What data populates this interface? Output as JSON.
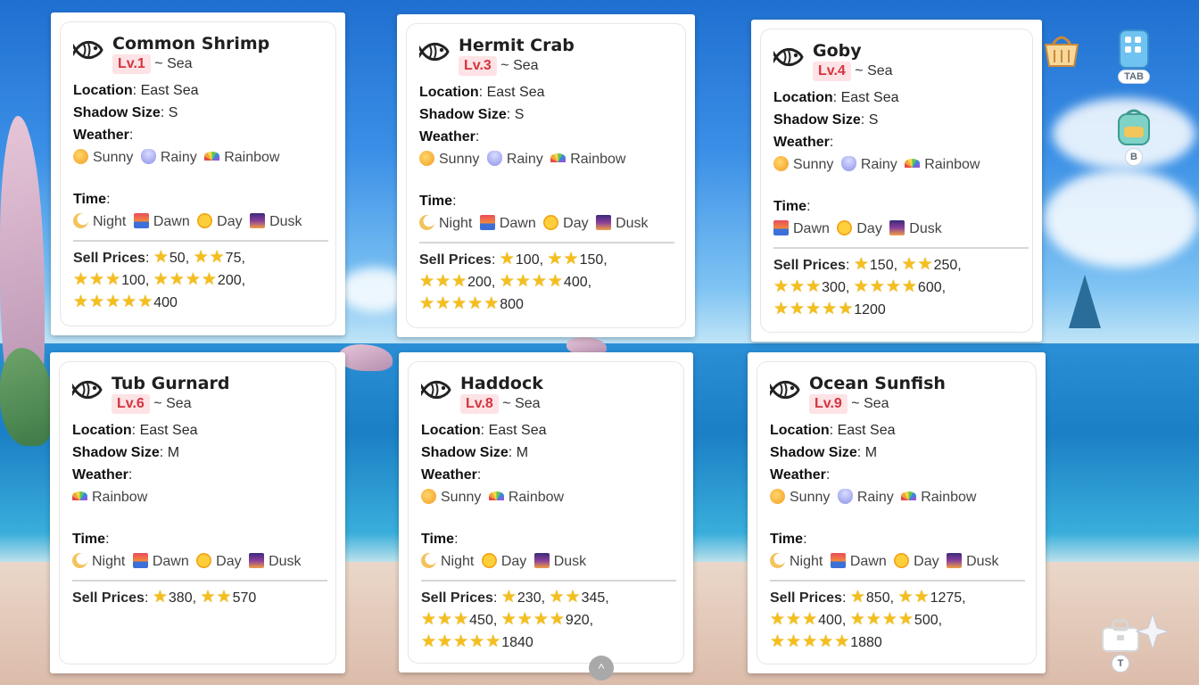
{
  "cards": [
    {
      "name": "Common Shrimp",
      "level": "Lv.1",
      "habitat": "~ Sea",
      "location_label": "Location",
      "location": "East Sea",
      "shadow_label": "Shadow Size",
      "shadow": "S",
      "weather_label": "Weather",
      "weather": [
        {
          "icon": "sunny-icon",
          "label": "Sunny"
        },
        {
          "icon": "rainy-icon",
          "label": "Rainy"
        },
        {
          "icon": "rainbow-icon",
          "label": "Rainbow"
        }
      ],
      "time_label": "Time",
      "time": [
        {
          "icon": "night-icon",
          "label": "Night"
        },
        {
          "icon": "dawn-icon",
          "label": "Dawn"
        },
        {
          "icon": "day-icon",
          "label": "Day"
        },
        {
          "icon": "dusk-icon",
          "label": "Dusk"
        }
      ],
      "sell_label": "Sell Prices",
      "prices": [
        {
          "stars": 1,
          "price": "50"
        },
        {
          "stars": 2,
          "price": "75"
        },
        {
          "stars": 3,
          "price": "100"
        },
        {
          "stars": 4,
          "price": "200"
        },
        {
          "stars": 5,
          "price": "400"
        }
      ]
    },
    {
      "name": "Hermit Crab",
      "level": "Lv.3",
      "habitat": "~ Sea",
      "location_label": "Location",
      "location": "East Sea",
      "shadow_label": "Shadow Size",
      "shadow": "S",
      "weather_label": "Weather",
      "weather": [
        {
          "icon": "sunny-icon",
          "label": "Sunny"
        },
        {
          "icon": "rainy-icon",
          "label": "Rainy"
        },
        {
          "icon": "rainbow-icon",
          "label": "Rainbow"
        }
      ],
      "time_label": "Time",
      "time": [
        {
          "icon": "night-icon",
          "label": "Night"
        },
        {
          "icon": "dawn-icon",
          "label": "Dawn"
        },
        {
          "icon": "day-icon",
          "label": "Day"
        },
        {
          "icon": "dusk-icon",
          "label": "Dusk"
        }
      ],
      "sell_label": "Sell Prices",
      "prices": [
        {
          "stars": 1,
          "price": "100"
        },
        {
          "stars": 2,
          "price": "150"
        },
        {
          "stars": 3,
          "price": "200"
        },
        {
          "stars": 4,
          "price": "400"
        },
        {
          "stars": 5,
          "price": "800"
        }
      ]
    },
    {
      "name": "Goby",
      "level": "Lv.4",
      "habitat": "~ Sea",
      "location_label": "Location",
      "location": "East Sea",
      "shadow_label": "Shadow Size",
      "shadow": "S",
      "weather_label": "Weather",
      "weather": [
        {
          "icon": "sunny-icon",
          "label": "Sunny"
        },
        {
          "icon": "rainy-icon",
          "label": "Rainy"
        },
        {
          "icon": "rainbow-icon",
          "label": "Rainbow"
        }
      ],
      "time_label": "Time",
      "time": [
        {
          "icon": "dawn-icon",
          "label": "Dawn"
        },
        {
          "icon": "day-icon",
          "label": "Day"
        },
        {
          "icon": "dusk-icon",
          "label": "Dusk"
        }
      ],
      "sell_label": "Sell Prices",
      "prices": [
        {
          "stars": 1,
          "price": "150"
        },
        {
          "stars": 2,
          "price": "250"
        },
        {
          "stars": 3,
          "price": "300"
        },
        {
          "stars": 4,
          "price": "600"
        },
        {
          "stars": 5,
          "price": "1200"
        }
      ]
    },
    {
      "name": "Tub Gurnard",
      "level": "Lv.6",
      "habitat": "~ Sea",
      "location_label": "Location",
      "location": "East Sea",
      "shadow_label": "Shadow Size",
      "shadow": "M",
      "weather_label": "Weather",
      "weather": [
        {
          "icon": "rainbow-icon",
          "label": "Rainbow"
        }
      ],
      "time_label": "Time",
      "time": [
        {
          "icon": "night-icon",
          "label": "Night"
        },
        {
          "icon": "dawn-icon",
          "label": "Dawn"
        },
        {
          "icon": "day-icon",
          "label": "Day"
        },
        {
          "icon": "dusk-icon",
          "label": "Dusk"
        }
      ],
      "sell_label": "Sell Prices",
      "prices": [
        {
          "stars": 1,
          "price": "380"
        },
        {
          "stars": 2,
          "price": "570"
        }
      ]
    },
    {
      "name": "Haddock",
      "level": "Lv.8",
      "habitat": "~ Sea",
      "location_label": "Location",
      "location": "East Sea",
      "shadow_label": "Shadow Size",
      "shadow": "M",
      "weather_label": "Weather",
      "weather": [
        {
          "icon": "sunny-icon",
          "label": "Sunny"
        },
        {
          "icon": "rainbow-icon",
          "label": "Rainbow"
        }
      ],
      "time_label": "Time",
      "time": [
        {
          "icon": "night-icon",
          "label": "Night"
        },
        {
          "icon": "day-icon",
          "label": "Day"
        },
        {
          "icon": "dusk-icon",
          "label": "Dusk"
        }
      ],
      "sell_label": "Sell Prices",
      "prices": [
        {
          "stars": 1,
          "price": "230"
        },
        {
          "stars": 2,
          "price": "345"
        },
        {
          "stars": 3,
          "price": "450"
        },
        {
          "stars": 4,
          "price": "920"
        },
        {
          "stars": 5,
          "price": "1840"
        }
      ]
    },
    {
      "name": "Ocean Sunfish",
      "level": "Lv.9",
      "habitat": "~ Sea",
      "location_label": "Location",
      "location": "East Sea",
      "shadow_label": "Shadow Size",
      "shadow": "M",
      "weather_label": "Weather",
      "weather": [
        {
          "icon": "sunny-icon",
          "label": "Sunny"
        },
        {
          "icon": "rainy-icon",
          "label": "Rainy"
        },
        {
          "icon": "rainbow-icon",
          "label": "Rainbow"
        }
      ],
      "time_label": "Time",
      "time": [
        {
          "icon": "night-icon",
          "label": "Night"
        },
        {
          "icon": "dawn-icon",
          "label": "Dawn"
        },
        {
          "icon": "day-icon",
          "label": "Day"
        },
        {
          "icon": "dusk-icon",
          "label": "Dusk"
        }
      ],
      "sell_label": "Sell Prices",
      "prices": [
        {
          "stars": 1,
          "price": "850"
        },
        {
          "stars": 2,
          "price": "1275"
        },
        {
          "stars": 3,
          "price": "400"
        },
        {
          "stars": 4,
          "price": "500"
        },
        {
          "stars": 5,
          "price": "1880"
        }
      ]
    }
  ],
  "hud": {
    "shop": {
      "icon": "basket-icon"
    },
    "tab": {
      "icon": "phone-icon",
      "key": "TAB"
    },
    "bag": {
      "icon": "backpack-icon",
      "key": "B"
    },
    "toolbox": {
      "icon": "toolbox-icon",
      "key": "T"
    }
  },
  "colors": {
    "level_bg": "#fde3e6",
    "level_text": "#d4353f",
    "star": "#f4bf1e"
  }
}
